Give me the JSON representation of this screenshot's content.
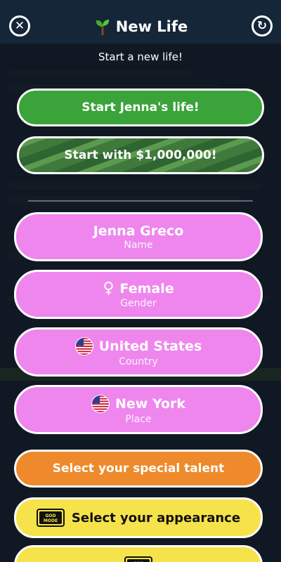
{
  "header": {
    "title": "New Life",
    "close_icon": "close-icon",
    "restart_icon": "restart-icon"
  },
  "subtitle": "Start a new life!",
  "actions": {
    "start_life": "Start Jenna's life!",
    "start_money": "Start with $1,000,000!"
  },
  "fields": [
    {
      "value": "Jenna Greco",
      "caption": "Name",
      "icon": ""
    },
    {
      "value": "Female",
      "caption": "Gender",
      "icon": "female-icon"
    },
    {
      "value": "United States",
      "caption": "Country",
      "icon": "us-flag-icon"
    },
    {
      "value": "New York",
      "caption": "Place",
      "icon": "us-flag-icon"
    }
  ],
  "talent_button": "Select your special talent",
  "appearance_button": "Select your appearance",
  "godmode_badge": "GOD MODE",
  "colors": {
    "green": "#3aa33a",
    "pink": "#ee86ee",
    "orange": "#ee8a2b",
    "yellow": "#f6e24a"
  }
}
